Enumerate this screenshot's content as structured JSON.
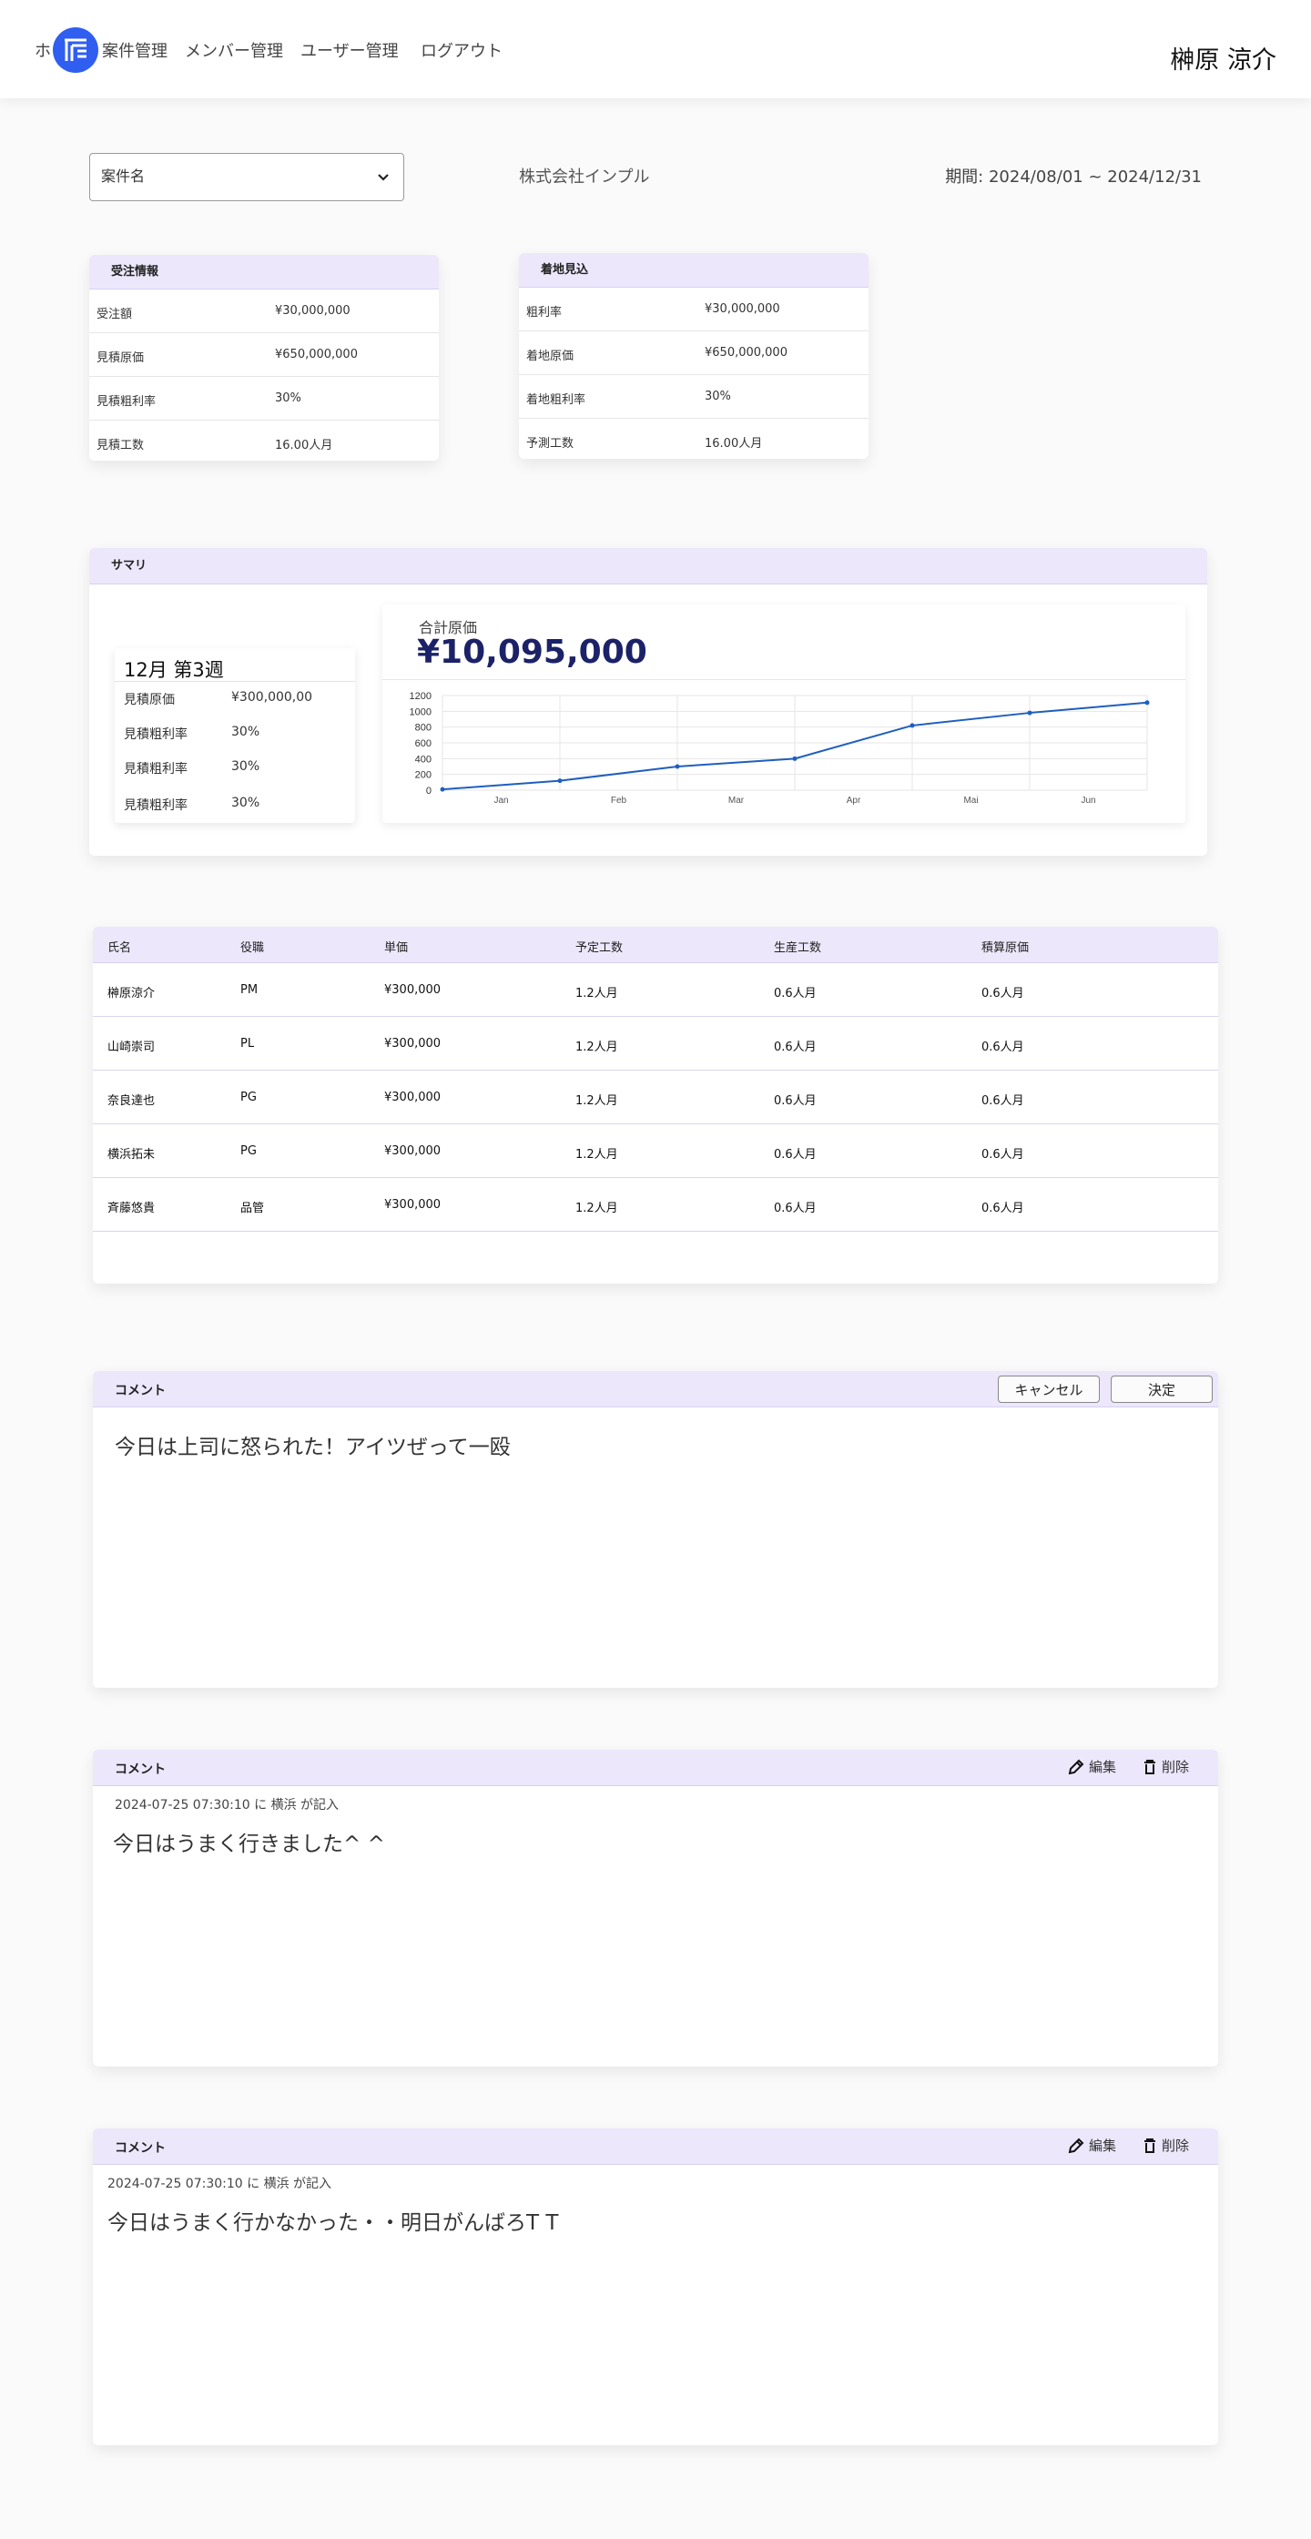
{
  "nav": {
    "home_partial": "ホ",
    "items": [
      "案件管理",
      "メンバー管理",
      "ユーザー管理",
      "ログアウト"
    ],
    "user_name": "榊原 涼介",
    "logo_color": "#2f5ef0"
  },
  "filters": {
    "project_placeholder": "案件名",
    "company": "株式会社インプル",
    "period": "期間: 2024/08/01 ~ 2024/12/31"
  },
  "order_info": {
    "title": "受注情報",
    "rows": [
      {
        "label": "受注額",
        "value": "¥30,000,000"
      },
      {
        "label": "見積原価",
        "value": "¥650,000,000"
      },
      {
        "label": "見積粗利率",
        "value": "30%"
      },
      {
        "label": "見積工数",
        "value": "16.00人月"
      }
    ]
  },
  "landing_forecast": {
    "title": "着地見込",
    "rows": [
      {
        "label": "粗利率",
        "value": "¥30,000,000"
      },
      {
        "label": "着地原価",
        "value": "¥650,000,000"
      },
      {
        "label": "着地粗利率",
        "value": "30%"
      },
      {
        "label": "予測工数",
        "value": "16.00人月"
      }
    ]
  },
  "summary": {
    "title": "サマリ",
    "week_card": {
      "title": "12月 第3週",
      "rows": [
        {
          "label": "見積原価",
          "value": "¥300,000,00"
        },
        {
          "label": "見積粗利率",
          "value": "30%"
        },
        {
          "label": "見積粗利率",
          "value": "30%"
        },
        {
          "label": "見積粗利率",
          "value": "30%"
        }
      ]
    },
    "total_label": "合計原価",
    "total_value": "¥10,095,000"
  },
  "chart_data": {
    "type": "line",
    "categories": [
      "Jan",
      "Feb",
      "Mar",
      "Apr",
      "Mai",
      "Jun"
    ],
    "x": [
      0,
      1,
      2,
      3,
      4,
      5,
      6
    ],
    "values": [
      10,
      120,
      300,
      400,
      820,
      980,
      1110
    ],
    "yticks": [
      0,
      200,
      400,
      600,
      800,
      1000,
      1200
    ],
    "ylim": [
      0,
      1200
    ],
    "grid": true,
    "color": "#1f5fbf"
  },
  "members": {
    "headers": [
      "氏名",
      "役職",
      "単価",
      "予定工数",
      "生産工数",
      "積算原価"
    ],
    "rows": [
      [
        "榊原涼介",
        "PM",
        "¥300,000",
        "1.2人月",
        "0.6人月",
        "0.6人月"
      ],
      [
        "山崎崇司",
        "PL",
        "¥300,000",
        "1.2人月",
        "0.6人月",
        "0.6人月"
      ],
      [
        "奈良達也",
        "PG",
        "¥300,000",
        "1.2人月",
        "0.6人月",
        "0.6人月"
      ],
      [
        "横浜拓未",
        "PG",
        "¥300,000",
        "1.2人月",
        "0.6人月",
        "0.6人月"
      ],
      [
        "斉藤悠貴",
        "品管",
        "¥300,000",
        "1.2人月",
        "0.6人月",
        "0.6人月"
      ]
    ]
  },
  "comment_edit": {
    "title": "コメント",
    "cancel_label": "キャンセル",
    "submit_label": "決定",
    "value": "今日は上司に怒られた！アイツぜって一殴"
  },
  "comments": [
    {
      "title": "コメント",
      "edit_label": "編集",
      "delete_label": "削除",
      "meta": "2024-07-25 07:30:10 に 横浜 が記入",
      "text": "今日はうまく行きました^ ^"
    },
    {
      "title": "コメント",
      "edit_label": "編集",
      "delete_label": "削除",
      "meta": "2024-07-25 07:30:10 に 横浜 が記入",
      "text": "今日はうまく行かなかった・・明日がんばろT T"
    }
  ],
  "colors": {
    "accent_header": "#ece7fb",
    "title_value": "#1b2268"
  }
}
